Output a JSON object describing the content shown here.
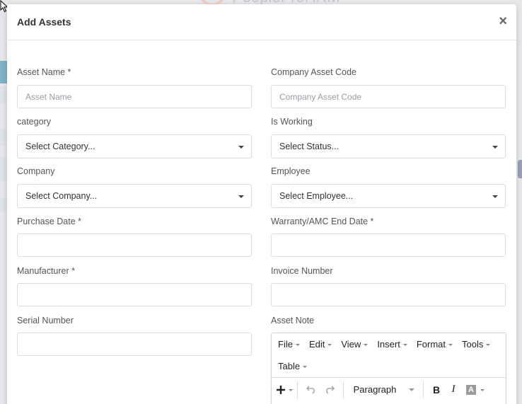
{
  "background": {
    "logo_text": "PeopleProHRM"
  },
  "modal": {
    "title": "Add Assets",
    "close_glyph": "×"
  },
  "fields": {
    "asset_name": {
      "label": "Asset Name *",
      "placeholder": "Asset Name",
      "value": ""
    },
    "company_asset_code": {
      "label": "Company Asset Code",
      "placeholder": "Company Asset Code",
      "value": ""
    },
    "category": {
      "label": "category",
      "selected": "Select Category..."
    },
    "is_working": {
      "label": "Is Working",
      "selected": "Select Status..."
    },
    "company": {
      "label": "Company",
      "selected": "Select Company..."
    },
    "employee": {
      "label": "Employee",
      "selected": "Select Employee..."
    },
    "purchase_date": {
      "label": "Purchase Date *",
      "value": ""
    },
    "warranty_end_date": {
      "label": "Warranty/AMC End Date *",
      "value": ""
    },
    "manufacturer": {
      "label": "Manufacturer *",
      "value": ""
    },
    "invoice_number": {
      "label": "Invoice Number",
      "value": ""
    },
    "serial_number": {
      "label": "Serial Number",
      "value": ""
    },
    "asset_note": {
      "label": "Asset Note"
    }
  },
  "editor": {
    "menus": [
      "File",
      "Edit",
      "View",
      "Insert",
      "Format",
      "Tools",
      "Table"
    ],
    "toolbar": {
      "block_format": "Paragraph",
      "icons": [
        "plus-icon",
        "undo-icon",
        "redo-icon",
        "bold-icon",
        "italic-icon",
        "text-color-icon"
      ],
      "bold_glyph": "B",
      "italic_glyph": "I",
      "color_glyph": "A"
    }
  },
  "colors": {
    "border": "#dcdce6",
    "text": "#333333",
    "placeholder": "#9b9ba6"
  }
}
